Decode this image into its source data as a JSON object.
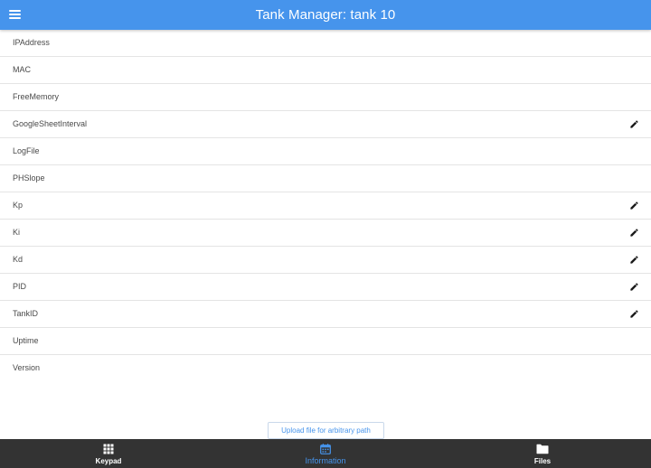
{
  "appbar": {
    "title": "Tank Manager: tank 10",
    "menu_icon": "hamburger-menu-icon",
    "color": "#4694ec"
  },
  "rows": [
    {
      "label": "IPAddress",
      "editable": false
    },
    {
      "label": "MAC",
      "editable": false
    },
    {
      "label": "FreeMemory",
      "editable": false
    },
    {
      "label": "GoogleSheetInterval",
      "editable": true
    },
    {
      "label": "LogFile",
      "editable": false
    },
    {
      "label": "PHSlope",
      "editable": false
    },
    {
      "label": "Kp",
      "editable": true
    },
    {
      "label": "Ki",
      "editable": true
    },
    {
      "label": "Kd",
      "editable": true
    },
    {
      "label": "PID",
      "editable": true
    },
    {
      "label": "TankID",
      "editable": true
    },
    {
      "label": "Uptime",
      "editable": false
    },
    {
      "label": "Version",
      "editable": false
    }
  ],
  "upload_button": {
    "label": "Upload file for arbitrary path"
  },
  "bottom_nav": {
    "items": [
      {
        "label": "Keypad",
        "icon": "keypad-grid-icon",
        "active": false
      },
      {
        "label": "Information",
        "icon": "calendar-icon",
        "active": true
      },
      {
        "label": "Files",
        "icon": "folder-icon",
        "active": false
      }
    ],
    "active_color": "#4694ec",
    "background": "#333333"
  }
}
